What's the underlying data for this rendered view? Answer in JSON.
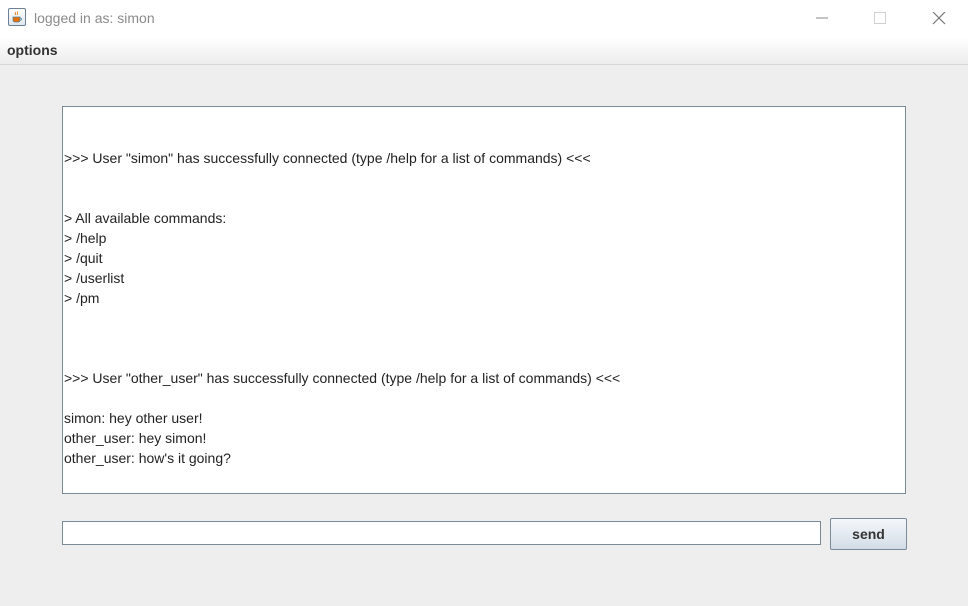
{
  "window": {
    "title": "logged in as: simon"
  },
  "menu": {
    "options_label": "options"
  },
  "chat": {
    "lines": [
      ">>> User \"simon\" has successfully connected (type /help for a list of commands) <<<",
      "> All available commands:",
      "> /help",
      "> /quit",
      "> /userlist",
      "> /pm",
      ">>> User \"other_user\" has successfully connected (type /help for a list of commands) <<<",
      "simon: hey other user!",
      "other_user: hey simon!",
      "other_user: how's it going?"
    ]
  },
  "input": {
    "value": "",
    "send_label": "send"
  },
  "icons": {
    "app": "java-cup-icon",
    "minimize": "minimize-icon",
    "maximize": "maximize-icon",
    "close": "close-icon"
  }
}
